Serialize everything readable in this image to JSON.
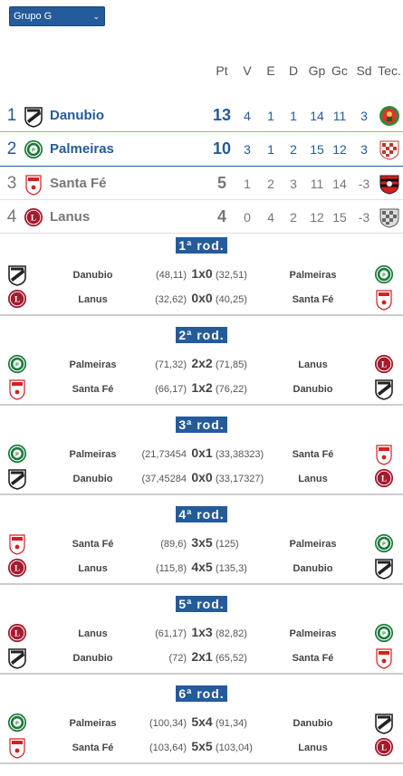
{
  "group_select": {
    "value": "Grupo G"
  },
  "standings": {
    "headers": [
      "Pt",
      "V",
      "E",
      "D",
      "Gp",
      "Gc",
      "Sd",
      "Tec."
    ],
    "rows": [
      {
        "pos": "1",
        "team": "Danubio",
        "pt": "13",
        "v": "4",
        "e": "1",
        "d": "1",
        "gp": "14",
        "gc": "11",
        "sd": "3",
        "color": "#245b9a"
      },
      {
        "pos": "2",
        "team": "Palmeiras",
        "pt": "10",
        "v": "3",
        "e": "1",
        "d": "2",
        "gp": "15",
        "gc": "12",
        "sd": "3",
        "color": "#245b9a"
      },
      {
        "pos": "3",
        "team": "Santa Fé",
        "pt": "5",
        "v": "1",
        "e": "2",
        "d": "3",
        "gp": "11",
        "gc": "14",
        "sd": "-3",
        "color": "#777777"
      },
      {
        "pos": "4",
        "team": "Lanus",
        "pt": "4",
        "v": "0",
        "e": "4",
        "d": "2",
        "gp": "12",
        "gc": "15",
        "sd": "-3",
        "color": "#777777"
      }
    ]
  },
  "rounds": [
    {
      "title": "1ª rod.",
      "matches": [
        {
          "home": "Danubio",
          "ph": "(48,11)",
          "score": "1x0",
          "pa": "(32,51)",
          "away": "Palmeiras",
          "hlogo": "danubio",
          "alogo": "palmeiras"
        },
        {
          "home": "Lanus",
          "ph": "(32,62)",
          "score": "0x0",
          "pa": "(40,25)",
          "away": "Santa Fé",
          "hlogo": "lanus",
          "alogo": "santafe"
        }
      ]
    },
    {
      "title": "2ª rod.",
      "matches": [
        {
          "home": "Palmeiras",
          "ph": "(71,32)",
          "score": "2x2",
          "pa": "(71,85)",
          "away": "Lanus",
          "hlogo": "palmeiras",
          "alogo": "lanus"
        },
        {
          "home": "Santa Fé",
          "ph": "(66,17)",
          "score": "1x2",
          "pa": "(76,22)",
          "away": "Danubio",
          "hlogo": "santafe",
          "alogo": "danubio"
        }
      ]
    },
    {
      "title": "3ª rod.",
      "matches": [
        {
          "home": "Palmeiras",
          "ph": "(21,73454",
          "score": "0x1",
          "pa": "(33,38323)",
          "away": "Santa Fé",
          "hlogo": "palmeiras",
          "alogo": "santafe"
        },
        {
          "home": "Danubio",
          "ph": "(37,45284",
          "score": "0x0",
          "pa": "(33,17327)",
          "away": "Lanus",
          "hlogo": "danubio",
          "alogo": "lanus"
        }
      ]
    },
    {
      "title": "4ª rod.",
      "matches": [
        {
          "home": "Santa Fé",
          "ph": "(89,6)",
          "score": "3x5",
          "pa": "(125)",
          "away": "Palmeiras",
          "hlogo": "santafe",
          "alogo": "palmeiras"
        },
        {
          "home": "Lanus",
          "ph": "(115,8)",
          "score": "4x5",
          "pa": "(135,3)",
          "away": "Danubio",
          "hlogo": "lanus",
          "alogo": "danubio"
        }
      ]
    },
    {
      "title": "5ª rod.",
      "matches": [
        {
          "home": "Lanus",
          "ph": "(61,17)",
          "score": "1x3",
          "pa": "(82,82)",
          "away": "Palmeiras",
          "hlogo": "lanus",
          "alogo": "palmeiras"
        },
        {
          "home": "Danubio",
          "ph": "(72)",
          "score": "2x1",
          "pa": "(65,52)",
          "away": "Santa Fé",
          "hlogo": "danubio",
          "alogo": "santafe"
        }
      ]
    },
    {
      "title": "6ª rod.",
      "matches": [
        {
          "home": "Palmeiras",
          "ph": "(100,34)",
          "score": "5x4",
          "pa": "(91,34)",
          "away": "Danubio",
          "hlogo": "palmeiras",
          "alogo": "danubio"
        },
        {
          "home": "Santa Fé",
          "ph": "(103,64)",
          "score": "5x5",
          "pa": "(103,04)",
          "away": "Lanus",
          "hlogo": "santafe",
          "alogo": "lanus"
        }
      ]
    }
  ],
  "coach_icons": [
    "coach-green-icon",
    "coach-checker-red-icon",
    "coach-red-black-icon",
    "coach-checker-grey-icon"
  ],
  "colors": {
    "accent": "#245b9a",
    "gold_separator": "#d4a64a",
    "blue_separator": "#245b9a"
  }
}
